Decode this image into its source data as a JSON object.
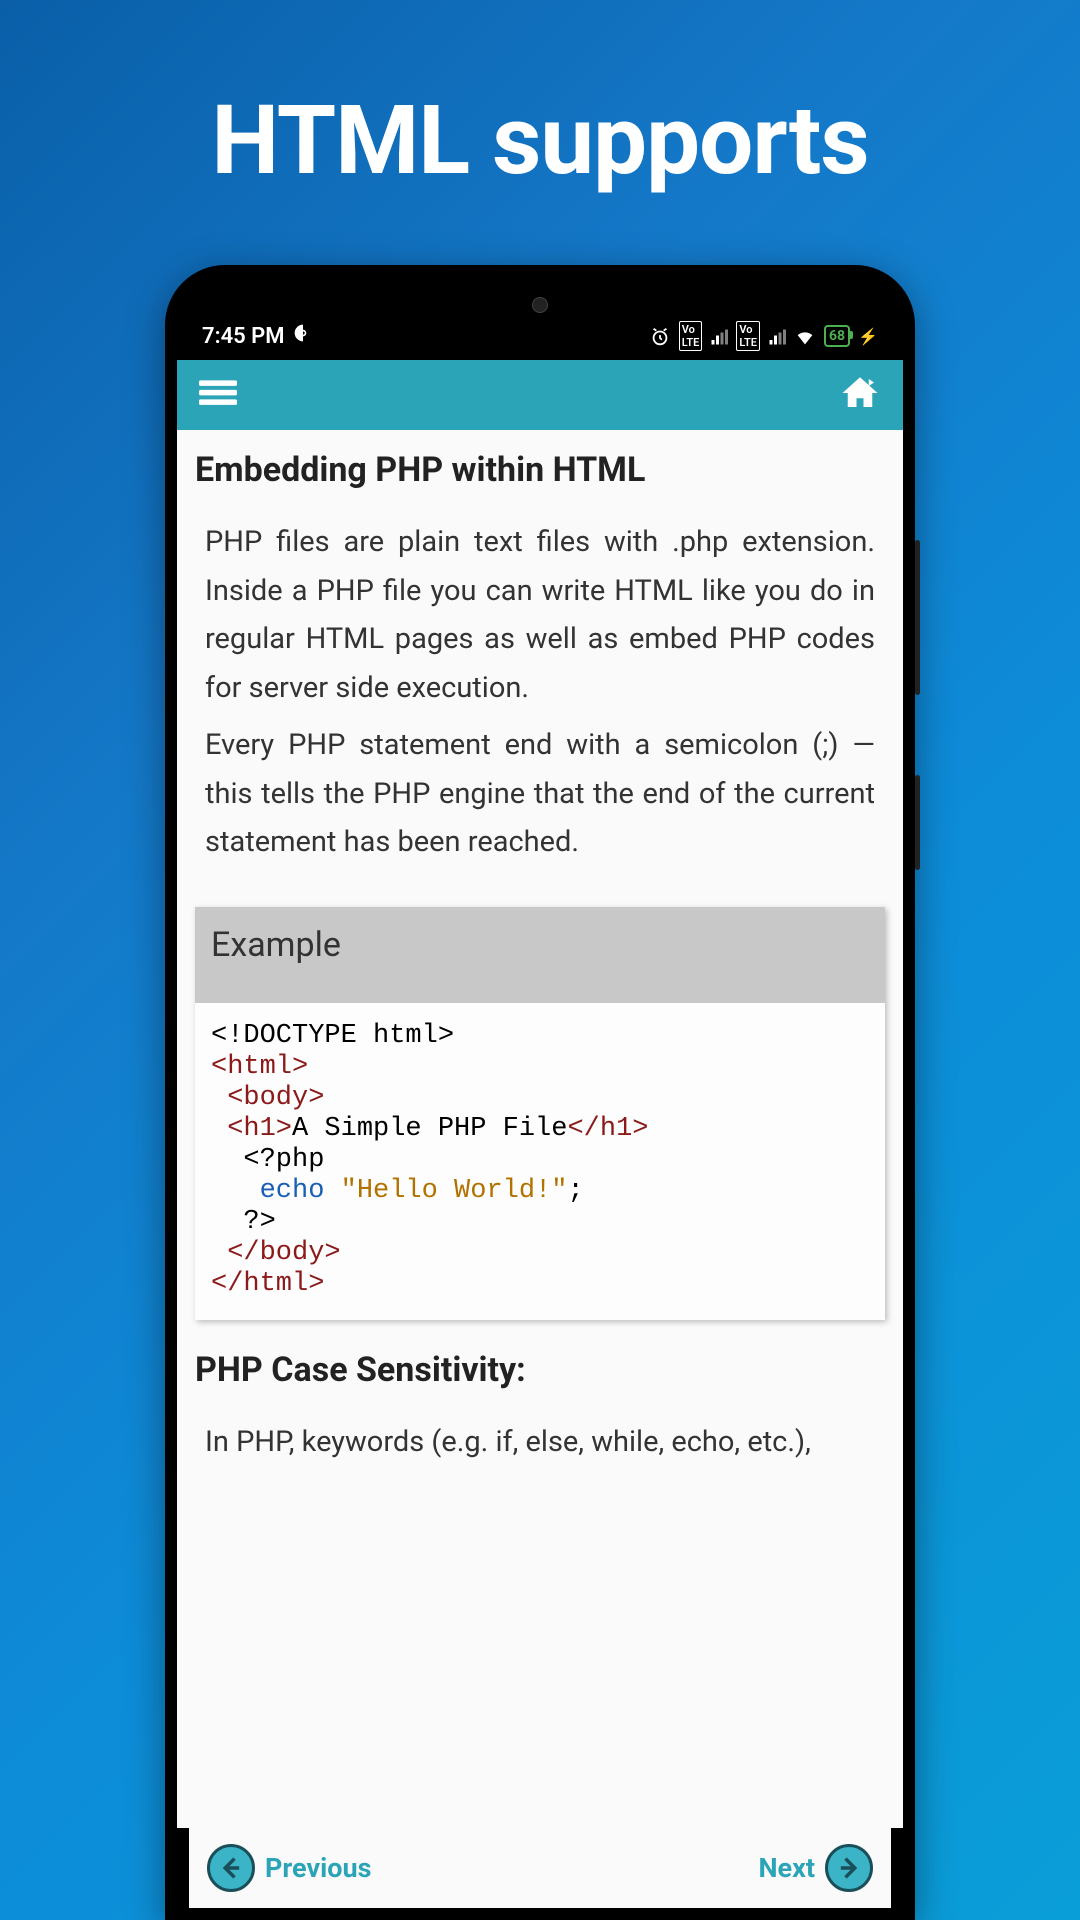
{
  "promo": {
    "title": "HTML supports"
  },
  "status": {
    "time": "7:45 PM",
    "battery": "68"
  },
  "content": {
    "heading1": "Embedding PHP within HTML",
    "para1": "PHP files are plain text files with .php extension. Inside a PHP file you can write HTML like you do in regular HTML pages as well as embed PHP codes for server side execution.",
    "para2": "Every PHP statement end with a semicolon (;) — this tells the PHP engine that the end of the current statement has been reached.",
    "example_label": "Example",
    "code": {
      "line1": "<!DOCTYPE html>",
      "line2_open": "<html>",
      "line3_open": " <body>",
      "line4_open": " <h1>",
      "line4_text": "A Simple PHP File",
      "line4_close": "</h1>",
      "line5": "  <?php",
      "line6_keyword": "echo",
      "line6_string": "\"Hello World!\"",
      "line6_semi": ";",
      "line7": "  ?>",
      "line8_close": " </body>",
      "line9_close": "</html>"
    },
    "heading2": "PHP Case Sensitivity:",
    "para3": "In PHP, keywords (e.g. if, else, while, echo, etc.),"
  },
  "nav": {
    "previous": "Previous",
    "next": "Next"
  }
}
